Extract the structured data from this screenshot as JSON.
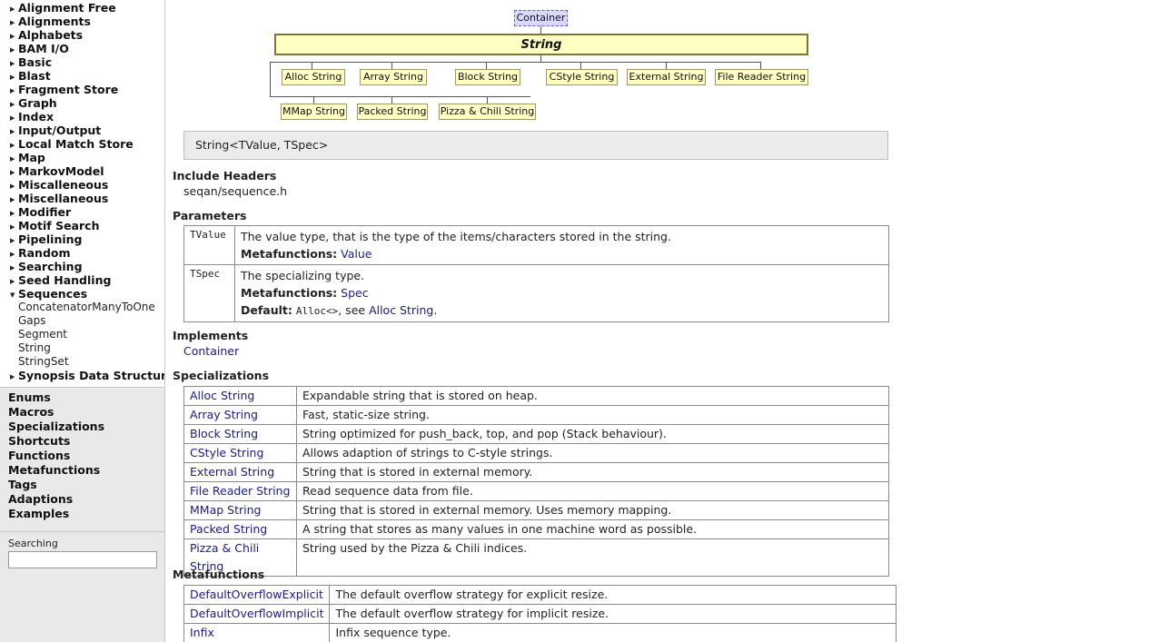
{
  "sidebar": {
    "categories": [
      {
        "label": "Alignment Free",
        "expanded": false
      },
      {
        "label": "Alignments",
        "expanded": false
      },
      {
        "label": "Alphabets",
        "expanded": false
      },
      {
        "label": "BAM I/O",
        "expanded": false
      },
      {
        "label": "Basic",
        "expanded": false
      },
      {
        "label": "Blast",
        "expanded": false
      },
      {
        "label": "Fragment Store",
        "expanded": false
      },
      {
        "label": "Graph",
        "expanded": false
      },
      {
        "label": "Index",
        "expanded": false
      },
      {
        "label": "Input/Output",
        "expanded": false
      },
      {
        "label": "Local Match Store",
        "expanded": false
      },
      {
        "label": "Map",
        "expanded": false
      },
      {
        "label": "MarkovModel",
        "expanded": false
      },
      {
        "label": "Miscalleneous",
        "expanded": false
      },
      {
        "label": "Miscellaneous",
        "expanded": false
      },
      {
        "label": "Modifier",
        "expanded": false
      },
      {
        "label": "Motif Search",
        "expanded": false
      },
      {
        "label": "Pipelining",
        "expanded": false
      },
      {
        "label": "Random",
        "expanded": false
      },
      {
        "label": "Searching",
        "expanded": false
      },
      {
        "label": "Seed Handling",
        "expanded": false
      },
      {
        "label": "Sequences",
        "expanded": true
      },
      {
        "label": "Synopsis Data Structures",
        "expanded": false
      }
    ],
    "sequences_children": [
      "ConcatenatorManyToOne",
      "Gaps",
      "Segment",
      "String",
      "StringSet"
    ],
    "lower_items": [
      "Enums",
      "Macros",
      "Specializations",
      "Shortcuts",
      "Functions",
      "Metafunctions",
      "Tags",
      "Adaptions",
      "Examples"
    ],
    "search": {
      "label": "Searching",
      "value": ""
    }
  },
  "diagram": {
    "parent": "Container",
    "main": "String",
    "row1": [
      "Alloc String",
      "Array String",
      "Block String",
      "CStyle String",
      "External String",
      "File Reader String"
    ],
    "row2": [
      "MMap String",
      "Packed String",
      "Pizza & Chili String"
    ]
  },
  "signature": "String<TValue, TSpec>",
  "include": {
    "title": "Include Headers",
    "value": "seqan/sequence.h"
  },
  "parameters": {
    "title": "Parameters",
    "tvalue": {
      "key": "TValue",
      "desc": "The value type, that is the type of the items/characters stored in the string.",
      "meta_label": "Metafunctions:",
      "meta_link": "Value"
    },
    "tspec": {
      "key": "TSpec",
      "desc": "The specializing type.",
      "meta_label": "Metafunctions:",
      "meta_link": "Spec",
      "default_label": "Default:",
      "default_code": "Alloc<>",
      "default_sep": ", see ",
      "default_link": "Alloc String",
      "default_end": "."
    }
  },
  "implements": {
    "title": "Implements",
    "value": "Container"
  },
  "specializations": {
    "title": "Specializations",
    "rows": [
      {
        "name": "Alloc String",
        "desc": "Expandable string that is stored on heap."
      },
      {
        "name": "Array String",
        "desc": "Fast, static-size string."
      },
      {
        "name": "Block String",
        "desc": "String optimized for push_back, top, and pop (Stack behaviour)."
      },
      {
        "name": "CStyle String",
        "desc": "Allows adaption of strings to C-style strings."
      },
      {
        "name": "External String",
        "desc": "String that is stored in external memory."
      },
      {
        "name": "File Reader String",
        "desc": "Read sequence data from file."
      },
      {
        "name": "MMap String",
        "desc": "String that is stored in external memory. Uses memory mapping."
      },
      {
        "name": "Packed String",
        "desc": "A string that stores as many values in one machine word as possible."
      },
      {
        "name": "Pizza & Chili String",
        "desc": "String used by the Pizza & Chili indices."
      }
    ]
  },
  "metafunctions": {
    "title": "Metafunctions",
    "rows": [
      {
        "name": "DefaultOverflowExplicit",
        "desc": "The default overflow strategy for explicit resize."
      },
      {
        "name": "DefaultOverflowImplicit",
        "desc": "The default overflow strategy for implicit resize."
      },
      {
        "name": "Infix",
        "desc": "Infix sequence type."
      }
    ]
  }
}
